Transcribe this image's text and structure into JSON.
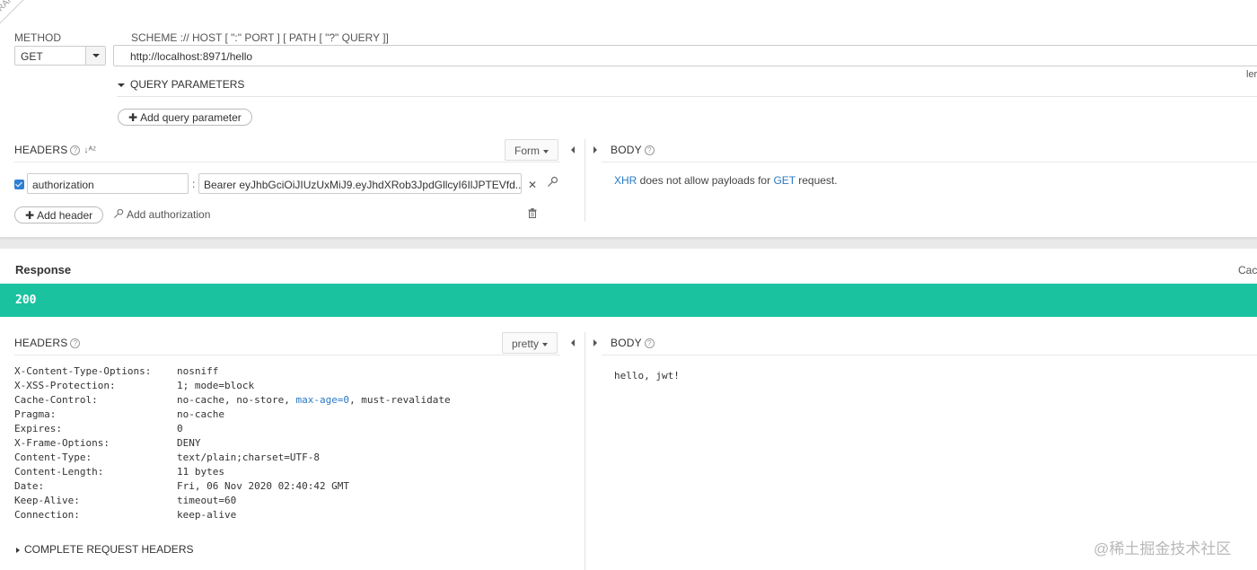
{
  "draft_label": "DRAFT",
  "request": {
    "method_label": "METHOD",
    "method_value": "GET",
    "url_label": "SCHEME :// HOST [ \":\" PORT ] [ PATH [ \"?\" QUERY ]]",
    "url_value": "http://localhost:8971/hello",
    "length_label": "ler",
    "query_params_label": "QUERY PARAMETERS",
    "add_query_label": "Add query parameter",
    "headers_label": "HEADERS",
    "headers_mode": "Form",
    "body_label": "BODY",
    "header_row": {
      "key": "authorization",
      "value": "Bearer eyJhbGciOiJIUzUxMiJ9.eyJhdXRob3JpdGllcyI6IlJPTEVfd..."
    },
    "add_header_label": "Add header",
    "add_auth_label": "Add authorization",
    "body_note": {
      "xhr": "XHR",
      "middle": " does not allow payloads for ",
      "method": "GET",
      "end": " request."
    }
  },
  "response": {
    "title": "Response",
    "cache_label": "Cac",
    "status": "200",
    "headers_label": "HEADERS",
    "headers_mode": "pretty",
    "body_label": "BODY",
    "headers": [
      {
        "key": "X-Content-Type-Options:",
        "value": "nosniff"
      },
      {
        "key": "X-XSS-Protection:",
        "value": "1; mode=block"
      },
      {
        "key": "Cache-Control:",
        "value": "no-cache, no-store, ",
        "link": "max-age=0",
        "tail": ", must-revalidate"
      },
      {
        "key": "Pragma:",
        "value": "no-cache"
      },
      {
        "key": "Expires:",
        "value": "0"
      },
      {
        "key": "X-Frame-Options:",
        "value": "DENY"
      },
      {
        "key": "Content-Type:",
        "value": "text/plain;charset=UTF-8"
      },
      {
        "key": "Content-Length:",
        "value": "11 bytes"
      },
      {
        "key": "Date:",
        "value": "Fri, 06 Nov 2020 02:40:42 GMT"
      },
      {
        "key": "Keep-Alive:",
        "value": "timeout=60"
      },
      {
        "key": "Connection:",
        "value": "keep-alive"
      }
    ],
    "body_text": "hello, jwt!",
    "complete_headers_label": "COMPLETE REQUEST HEADERS"
  },
  "watermark": "@稀土掘金技术社区",
  "colors": {
    "status_bar": "#1bc2a0",
    "link_blue": "#2a79c4",
    "checkbox_blue": "#2f7fd6"
  }
}
